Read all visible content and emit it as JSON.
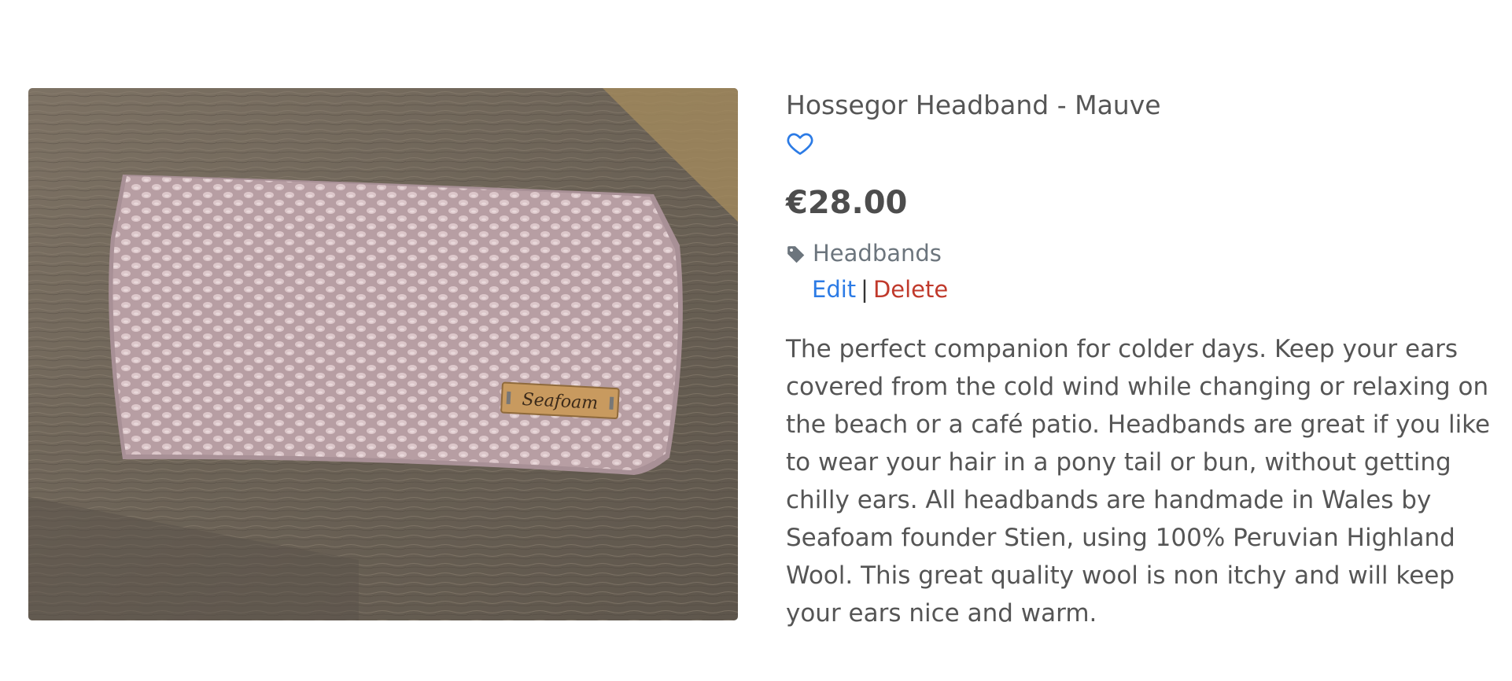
{
  "product": {
    "image_alt": "Hossegor Headband - Mauve",
    "label_text": "Seafoam",
    "title": "Hossegor Headband - Mauve",
    "price": "€28.00",
    "category": "Headbands",
    "description": "The perfect companion for colder days. Keep your ears covered from the cold wind while changing or relaxing on the beach or a café patio. Headbands are great if you like to wear your hair in a pony tail or bun, without getting chilly ears. All headbands are handmade in Wales by Seafoam founder Stien, using 100% Peruvian Highland Wool. This great quality wool is non itchy and will keep your ears nice and warm."
  },
  "actions": {
    "edit_label": "Edit",
    "separator": "|",
    "delete_label": "Delete"
  },
  "icons": {
    "favorite": "heart-outline-icon",
    "category": "tag-icon"
  },
  "colors": {
    "link": "#2c7be5",
    "danger": "#c0392b",
    "text": "#555555"
  }
}
